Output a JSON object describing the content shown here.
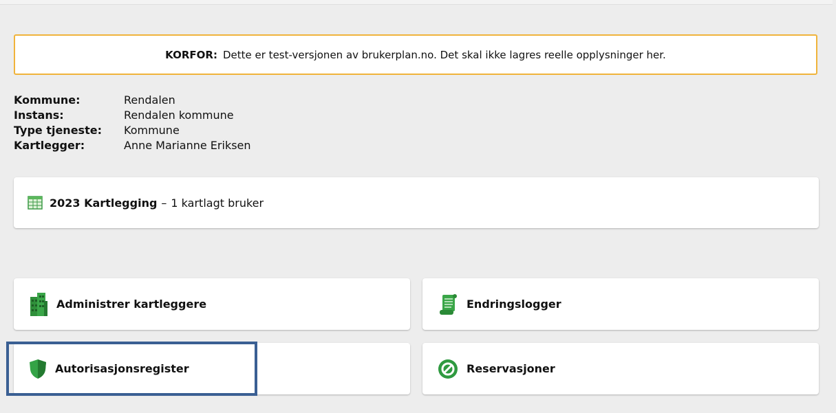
{
  "banner": {
    "label": "KORFOR:",
    "text": "Dette er test-versjonen av brukerplan.no. Det skal ikke lagres reelle opplysninger her."
  },
  "info": [
    {
      "key": "Kommune:",
      "value": "Rendalen"
    },
    {
      "key": "Instans:",
      "value": "Rendalen kommune"
    },
    {
      "key": "Type tjeneste:",
      "value": "Kommune"
    },
    {
      "key": "Kartlegger:",
      "value": "Anne Marianne Eriksen"
    }
  ],
  "survey": {
    "title": "2023 Kartlegging",
    "separator": "–",
    "detail": "1 kartlagt bruker",
    "icon": "spreadsheet-icon"
  },
  "tiles": [
    {
      "label": "Administrer kartleggere",
      "icon": "buildings-icon"
    },
    {
      "label": "Endringslogger",
      "icon": "scroll-icon"
    },
    {
      "label": "Autorisasjonsregister",
      "icon": "shield-icon"
    },
    {
      "label": "Reservasjoner",
      "icon": "no-entry-icon"
    }
  ],
  "colors": {
    "banner_border": "#f0b33a",
    "icon_green": "#2e8b3a",
    "highlight": "#3a5f93"
  }
}
